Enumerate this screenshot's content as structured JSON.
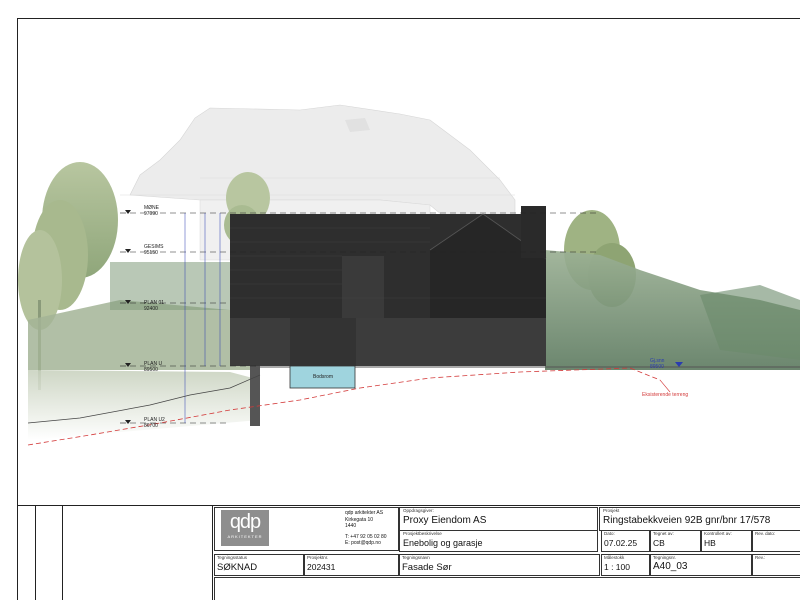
{
  "levels": [
    {
      "name": "MØNE",
      "value": "97090"
    },
    {
      "name": "GESIMS",
      "value": "95150"
    },
    {
      "name": "PLAN 01",
      "value": "92400"
    },
    {
      "name": "PLAN U",
      "value": "89500"
    },
    {
      "name": "PLAN U2",
      "value": "86700"
    }
  ],
  "labels": {
    "basement": "Bodsrom",
    "existing_terrain": "Eksisterende terreng",
    "ground_floor": "Gj.snn",
    "ground_floor_value": "89500"
  },
  "company": {
    "logo_text": "qdp",
    "logo_sub": "ARKITEKTER",
    "name": "qdp arkitekter AS",
    "address1": "Kirkegata 10",
    "address2": "1440",
    "phone": "T: +47 92 05 02 80",
    "email": "E: post@qdp.no"
  },
  "titleblock": {
    "client_label": "Oppdragsgiver:",
    "client": "Proxy Eiendom AS",
    "project_label": "Prosjekt",
    "project": "Ringstabekkveien 92B gnr/bnr 17/578",
    "desc_label": "Prosjektbeskrivelse",
    "desc": "Enebolig og garasje",
    "date_label": "Dato:",
    "date": "07.02.25",
    "drawn_label": "Tegnet av:",
    "drawn": "CB",
    "checked_label": "Kontrollert av:",
    "checked": "HB",
    "rev_date_label": "Rev. dato:",
    "rev_date": "",
    "status_label": "Tegningsstatus",
    "status": "SØKNAD",
    "projno_label": "Prosjektnr.",
    "projno": "202431",
    "drawing_label": "Tegningsnavn",
    "drawing": "Fasade Sør",
    "scale_label": "Målestokk",
    "scale": "1 : 100",
    "drawno_label": "Tegningsnr.",
    "drawno": "A40_03",
    "rev_label": "Rev.:",
    "rev": ""
  },
  "colors": {
    "building": "#2e2e2e",
    "tree": "#9fb383",
    "hill": "#7f9a7a",
    "ghost": "#e4e4e4",
    "dim_blue": "#2a3cb0",
    "terrain_red": "#d33a3a",
    "water": "#9fd4de"
  }
}
